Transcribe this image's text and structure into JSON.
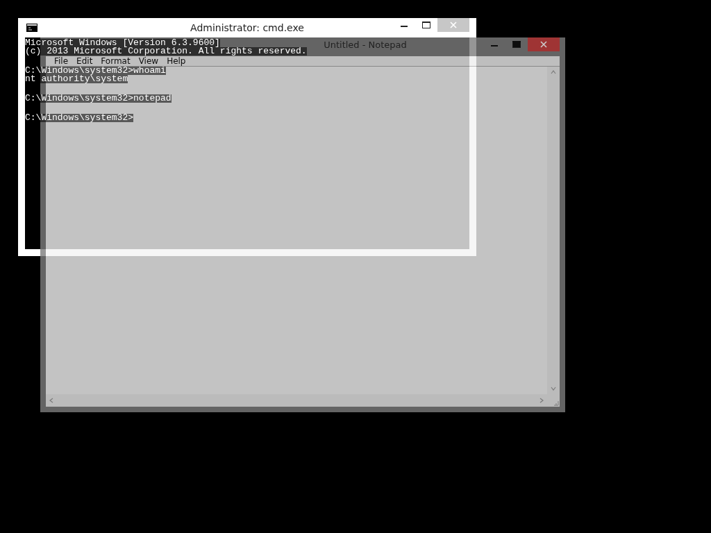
{
  "cmd_window": {
    "title": "Administrator: cmd.exe",
    "console_blocks": [
      [
        "Microsoft Windows [Version 6.3.9600]",
        "(c) 2013 Microsoft Corporation. All rights reserved."
      ],
      [
        "C:\\Windows\\system32>whoami",
        "nt authority\\system"
      ],
      [
        "C:\\Windows\\system32>notepad"
      ],
      [
        "C:\\Windows\\system32>"
      ]
    ]
  },
  "notepad_window": {
    "title": "Untitled - Notepad",
    "menu": [
      "File",
      "Edit",
      "Format",
      "View",
      "Help"
    ]
  }
}
